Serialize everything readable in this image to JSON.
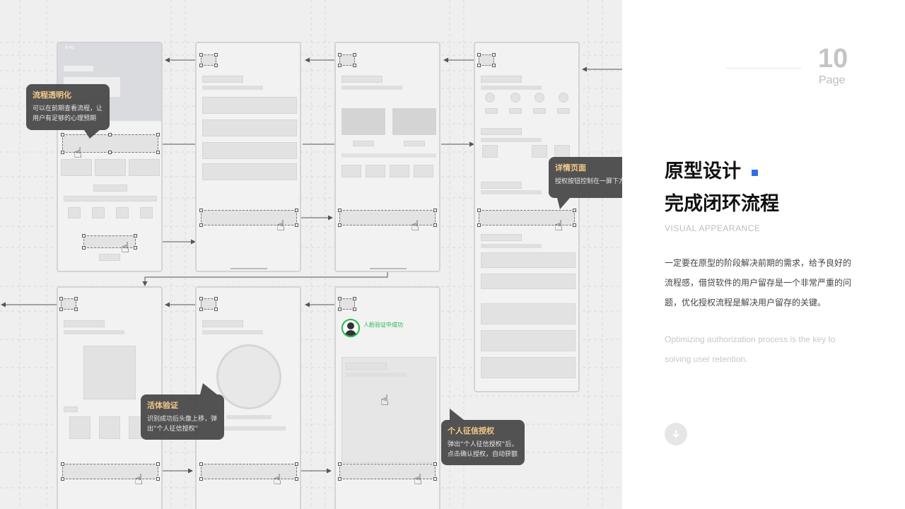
{
  "page": {
    "number": "10",
    "label": "Page"
  },
  "heading": {
    "line1": "原型设计",
    "line2": "完成闭环流程"
  },
  "subtitle": "VISUAL  APPEARANCE",
  "description": "一定要在原型的阶段解决前期的需求，给予良好的流程感，借贷软件的用户留存是一个非常严重的问题，优化授权流程是解决用户留存的关键。",
  "description_en": "Optimizing authorization process is the key to solving user retention.",
  "phone_status_time": "9:41",
  "face_verify_text": "人脸验证中成功",
  "callouts": [
    {
      "title": "流程透明化",
      "body": "可以在前期查看流程，让用户有足够的心理预期"
    },
    {
      "title": "详情页面",
      "body": "授权按钮控制在一屏下方"
    },
    {
      "title": "活体验证",
      "body": "识别成功后头像上移，弹出“个人征信授权”"
    },
    {
      "title": "个人征信授权",
      "body": "弹出“个人征信授权”后，点击确认授权，自动获额"
    }
  ],
  "colors": {
    "accent": "#2f6fe6",
    "callout_title": "#f5c98a",
    "success": "#22b84a"
  },
  "icons": [
    "tap-hand-icon",
    "swipe-hand-icon",
    "arrow-down-icon",
    "avatar-icon"
  ]
}
